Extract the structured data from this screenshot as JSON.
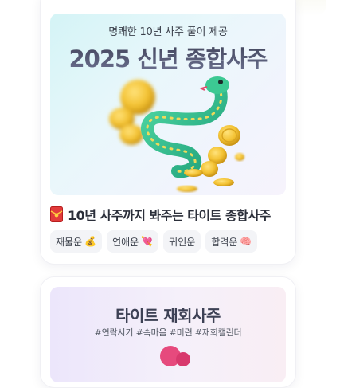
{
  "card1": {
    "subtitle": "명쾌한 10년 사주 풀이 제공",
    "title": "2025 신년 종합사주",
    "heading_icon": "red-envelope-icon",
    "heading": "10년 사주까지 봐주는 타이트 종합사주",
    "tags": [
      {
        "label": "재물운",
        "emoji": "💰",
        "icon": "money-bag-icon"
      },
      {
        "label": "연애운",
        "emoji": "💘",
        "icon": "heart-arrow-icon"
      },
      {
        "label": "귀인운",
        "emoji": "",
        "icon": ""
      },
      {
        "label": "합격운",
        "emoji": "🧠",
        "icon": "brain-icon"
      }
    ],
    "illustration": "snake-with-gold-coins"
  },
  "card2": {
    "title": "타이트 재회사주",
    "hashtags": "#연락시기 #속마음 #미련 #재회캘린더"
  },
  "colors": {
    "accent_snake": "#35c48c",
    "coin_gold": "#f3c233",
    "title_gray": "#4a4f66"
  }
}
